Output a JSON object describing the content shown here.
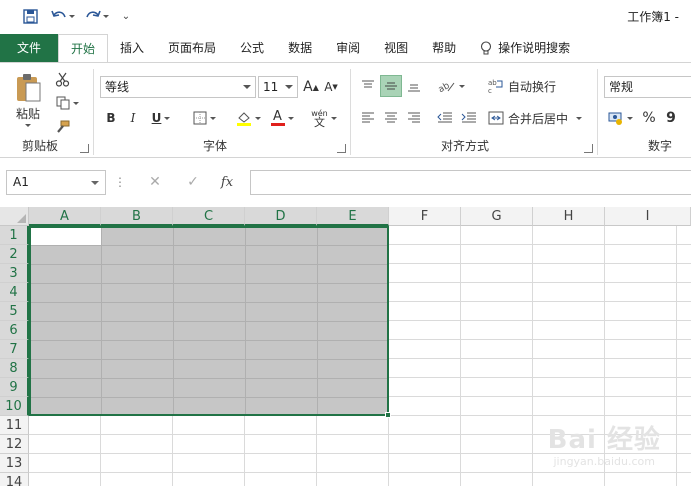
{
  "window": {
    "title": "工作簿1 -"
  },
  "qat": {
    "undo_label": "撤销",
    "redo_label": "恢复"
  },
  "tabs": [
    {
      "label": "文件"
    },
    {
      "label": "开始"
    },
    {
      "label": "插入"
    },
    {
      "label": "页面布局"
    },
    {
      "label": "公式"
    },
    {
      "label": "数据"
    },
    {
      "label": "审阅"
    },
    {
      "label": "视图"
    },
    {
      "label": "帮助"
    }
  ],
  "tell_me": "操作说明搜索",
  "clipboard": {
    "paste_label": "粘贴",
    "group_label": "剪贴板"
  },
  "font": {
    "name": "等线",
    "size": "11",
    "grow_label": "A",
    "shrink_label": "A",
    "bold": "B",
    "italic": "I",
    "underline": "U",
    "font_color_label": "A",
    "phonetic_top": "wén",
    "phonetic_bottom": "文",
    "group_label": "字体"
  },
  "alignment": {
    "wrap_text": "自动换行",
    "merge_center": "合并后居中",
    "group_label": "对齐方式"
  },
  "number": {
    "format": "常规",
    "percent": "%",
    "comma": "9",
    "group_label": "数字"
  },
  "formula_bar": {
    "name_box": "A1",
    "fx": "fx",
    "cancel": "✕",
    "enter": "✓",
    "content": ""
  },
  "grid": {
    "columns": [
      "A",
      "B",
      "C",
      "D",
      "E",
      "F",
      "G",
      "H",
      "I"
    ],
    "rows": [
      "1",
      "2",
      "3",
      "4",
      "5",
      "6",
      "7",
      "8",
      "9",
      "10",
      "11",
      "12",
      "13",
      "14"
    ],
    "selected_columns": [
      "A",
      "B",
      "C",
      "D",
      "E"
    ],
    "selected_rows": [
      "1",
      "2",
      "3",
      "4",
      "5",
      "6",
      "7",
      "8",
      "9",
      "10"
    ],
    "selection_color": "#c6c6c6",
    "accent_color": "#217346"
  },
  "watermark": {
    "brand": "Bai 经验",
    "url": "jingyan.baidu.com"
  }
}
